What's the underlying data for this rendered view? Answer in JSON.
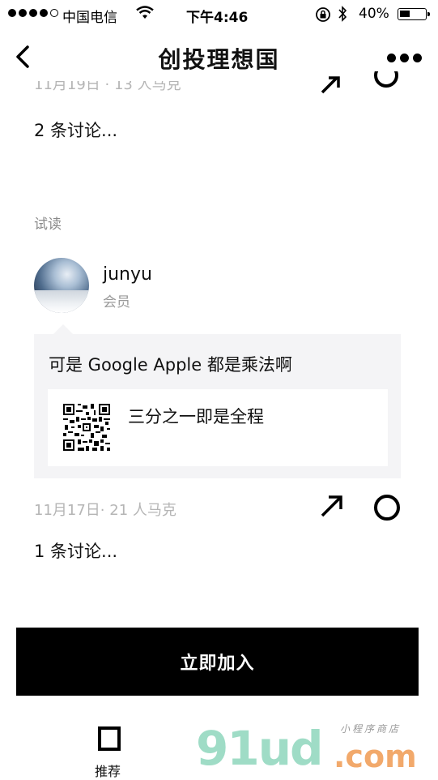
{
  "status_bar": {
    "carrier": "中国电信",
    "time": "下午4:46",
    "battery": "40%",
    "battery_level": 0.4
  },
  "nav": {
    "title": "创投理想国"
  },
  "previous_item": {
    "meta": "11月19日 · 13 人马克",
    "discussions": "2 条讨论..."
  },
  "section": {
    "label": "试读"
  },
  "post": {
    "user_name": "junyu",
    "user_role": "会员",
    "text": "可是 Google Apple 都是乘法啊",
    "link_title": "三分之一即是全程",
    "meta": "11月17日· 21 人马克",
    "discussions": "1 条讨论..."
  },
  "join_button": "立即加入",
  "tab_bar": {
    "items": [
      {
        "label": "推荐",
        "icon": "square-icon"
      }
    ]
  },
  "watermark": {
    "main": "91ud",
    "suffix": ".com",
    "small": "小程序商店"
  }
}
